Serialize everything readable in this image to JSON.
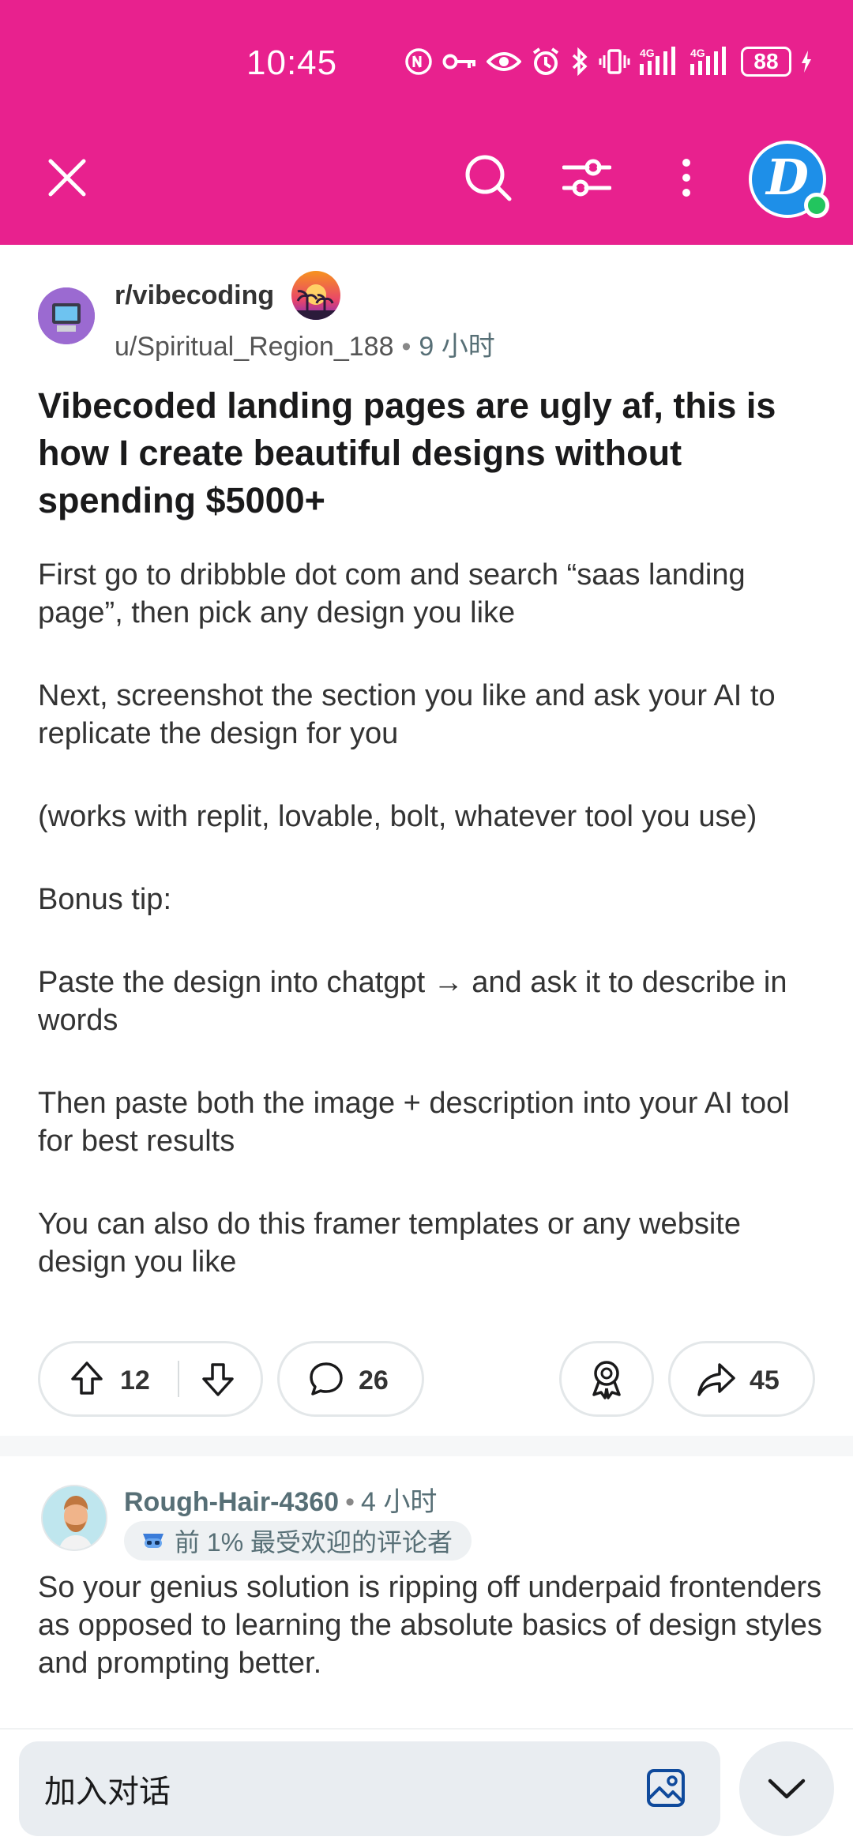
{
  "status_bar": {
    "time": "10:45",
    "battery": "88",
    "icons": [
      "nfc-icon",
      "key-icon",
      "eye-icon",
      "alarm-icon",
      "bluetooth-icon",
      "vibrate-icon",
      "signal-4g-icon",
      "signal-4g-icon"
    ]
  },
  "header": {
    "bg_color": "#E8218E",
    "close_icon": "close-icon",
    "search_icon": "search-icon",
    "filter_icon": "filter-icon",
    "more_icon": "more-vertical-icon",
    "avatar_letter": "D"
  },
  "post": {
    "community": "r/vibecoding",
    "author": "u/Spiritual_Region_188",
    "dot": "•",
    "age": "9 小时",
    "title": "Vibecoded landing pages are ugly af, this is how I create beautiful designs without spending $5000+",
    "paragraphs": [
      "First go to dribbble dot com and search “saas landing page”, then pick any design you like",
      "Next, screenshot the section you like and ask your AI to replicate the design for you",
      "(works with replit, lovable, bolt, whatever tool you use)",
      "Bonus tip:",
      "Paste the design into chatgpt → and ask it to describe in words",
      "Then paste both the image + description into your AI tool for best results",
      "You can also do this framer templates or any website design you like"
    ],
    "upvotes": "12",
    "comments": "26",
    "shares": "45"
  },
  "comment": {
    "author": "Rough-Hair-4360",
    "dot": "•",
    "age": "4 小时",
    "flair": "前 1% 最受欢迎的评论者",
    "body": "So your genius solution is ripping off underpaid frontenders as opposed to learning the absolute basics of design styles and prompting better."
  },
  "composer": {
    "placeholder": "加入对话"
  }
}
